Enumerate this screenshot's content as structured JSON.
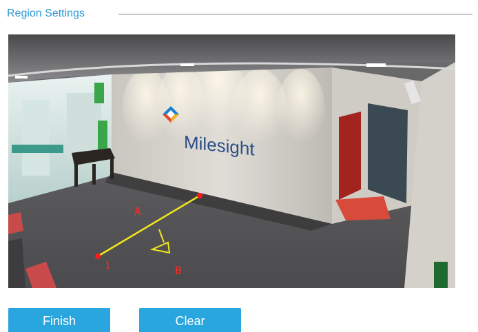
{
  "section": {
    "title": "Region Settings"
  },
  "video": {
    "brand_text": "Milesight",
    "line_labels": {
      "side_a": "A",
      "side_b": "B",
      "line_id": "1"
    }
  },
  "buttons": {
    "finish_label": "Finish",
    "clear_label": "Clear"
  },
  "colors": {
    "accent": "#2aa6de",
    "title": "#2e9ad3",
    "line": "#f5e61c",
    "endpoint": "#ff1a1a",
    "label": "#ff2a2a"
  }
}
